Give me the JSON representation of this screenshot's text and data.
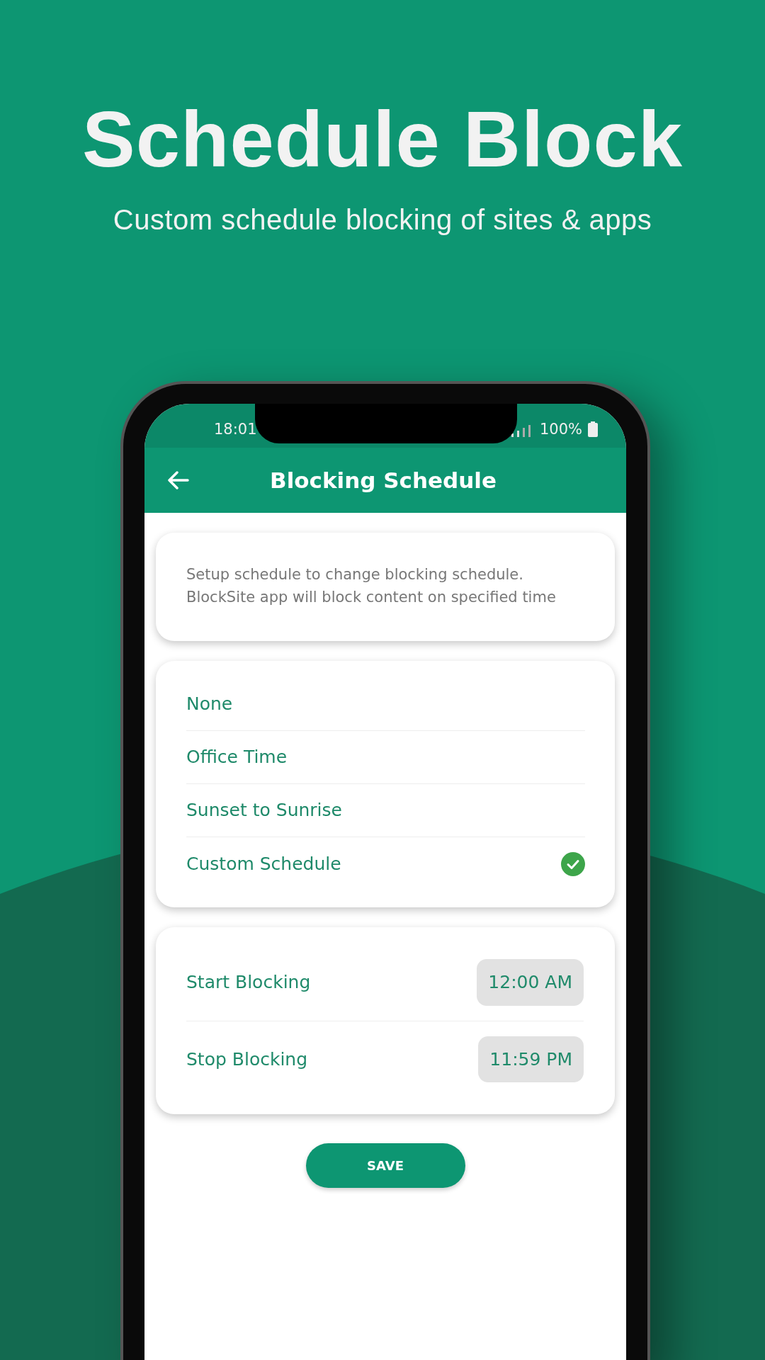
{
  "headline": "Schedule Block",
  "subtitle": "Custom schedule blocking of sites & apps",
  "status_bar": {
    "time": "18:01",
    "battery": "100%"
  },
  "app_bar": {
    "title": "Blocking Schedule"
  },
  "info_text": "Setup schedule to change blocking schedule. BlockSite app will block content on specified time",
  "schedule_options": [
    {
      "label": "None",
      "selected": false
    },
    {
      "label": "Office Time",
      "selected": false
    },
    {
      "label": "Sunset to Sunrise",
      "selected": false
    },
    {
      "label": "Custom Schedule",
      "selected": true
    }
  ],
  "times": [
    {
      "label": "Start Blocking",
      "value": "12:00 AM"
    },
    {
      "label": "Stop Blocking",
      "value": "11:59 PM"
    }
  ],
  "save_button": "SAVE"
}
